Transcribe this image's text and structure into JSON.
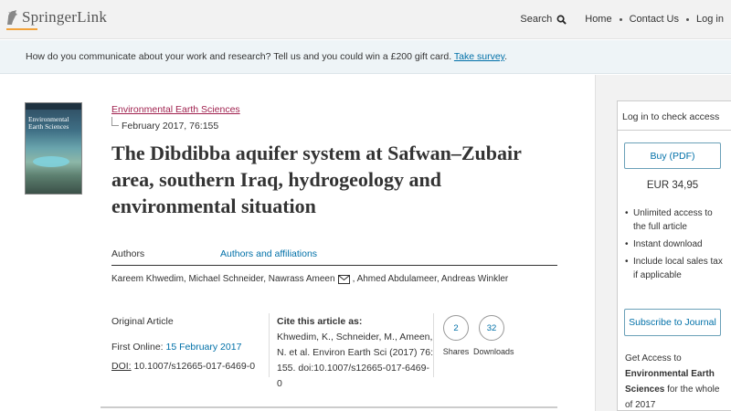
{
  "header": {
    "logo_brand": "Springer",
    "logo_suffix": "Link",
    "nav": {
      "search_label": "Search",
      "home": "Home",
      "contact": "Contact Us",
      "login": "Log in"
    },
    "colors": {
      "logo_accent": "#f2a23a"
    }
  },
  "banner": {
    "text": "How do you communicate about your work and research? Tell us and you could win a £200 gift card.",
    "link": "Take survey",
    "end": "."
  },
  "article": {
    "cover_title": "Environmental Earth Sciences",
    "journal": "Environmental Earth Sciences",
    "issue": "February 2017, 76:155",
    "title": "The Dibdibba aquifer system at Safwan–Zubair area, southern Iraq, hydrogeology and environmental situation",
    "tabs": {
      "authors": "Authors",
      "affiliations": "Authors and affiliations"
    },
    "authors_part1": "Kareem Khwedim, Michael Schneider, Nawrass Ameen",
    "authors_part2": ", Ahmed Abdulameer, Andreas Winkler",
    "type": "Original Article",
    "first_online_label": "First Online:",
    "first_online_value": "15 February 2017",
    "doi_label": "DOI:",
    "doi_value": "10.1007/s12665-017-6469-0",
    "cite_heading": "Cite this article as:",
    "cite_text": "Khwedim, K., Schneider, M., Ameen, N. et al. Environ Earth Sci (2017) 76: 155. doi:10.1007/s12665-017-6469-0",
    "metrics": {
      "shares_value": "2",
      "shares_label": "Shares",
      "downloads_value": "32",
      "downloads_label": "Downloads"
    }
  },
  "sidebar": {
    "access_title": "Log in to check access",
    "buy_label": "Buy (PDF)",
    "price": "EUR 34,95",
    "benefits": [
      "Unlimited access to the full article",
      "Instant download",
      "Include local sales tax if applicable"
    ],
    "subscribe_label": "Subscribe to Journal",
    "get_access_pre": "Get Access to",
    "get_access_journal": "Environmental Earth Sciences",
    "get_access_post": "for the whole of 2017"
  },
  "icons": {
    "search": "search-icon",
    "mail": "mail-icon",
    "logo": "springer-horse-icon"
  },
  "colors": {
    "link_blue": "#0070a8",
    "journal_link": "#a0224f"
  }
}
